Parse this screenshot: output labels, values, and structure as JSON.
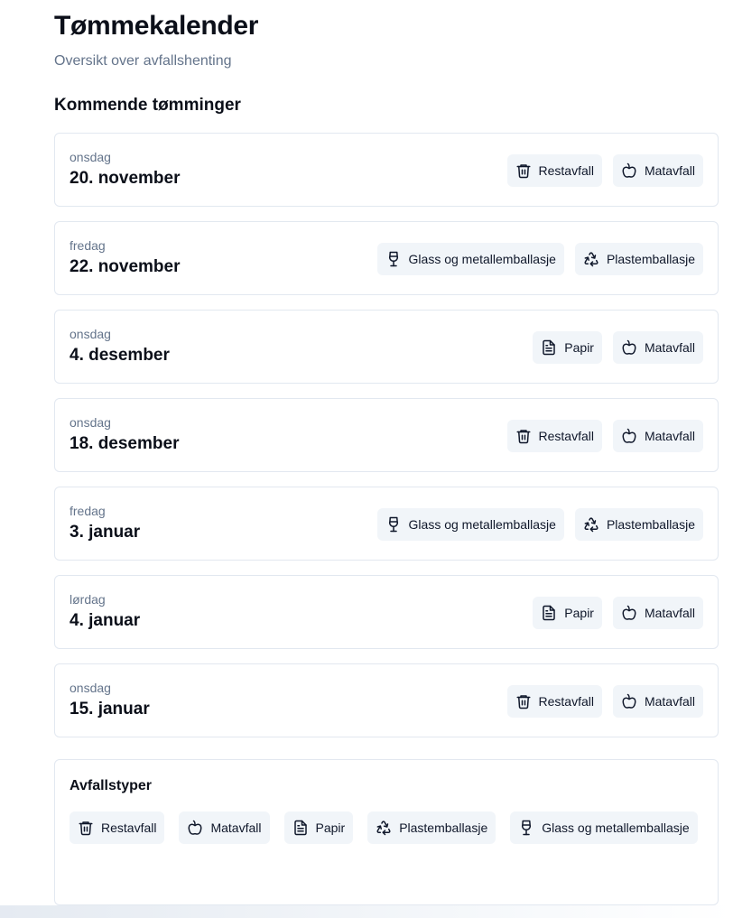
{
  "header": {
    "title": "Tømmekalender",
    "subtitle": "Oversikt over avfallshenting"
  },
  "upcoming": {
    "heading": "Kommende tømminger",
    "items": [
      {
        "day": "onsdag",
        "date": "20. november",
        "types": [
          {
            "label": "Restavfall",
            "icon": "trash-icon"
          },
          {
            "label": "Matavfall",
            "icon": "apple-icon"
          }
        ]
      },
      {
        "day": "fredag",
        "date": "22. november",
        "types": [
          {
            "label": "Glass og metallemballasje",
            "icon": "wine-glass-icon"
          },
          {
            "label": "Plastemballasje",
            "icon": "recycle-icon"
          }
        ]
      },
      {
        "day": "onsdag",
        "date": "4. desember",
        "types": [
          {
            "label": "Papir",
            "icon": "document-icon"
          },
          {
            "label": "Matavfall",
            "icon": "apple-icon"
          }
        ]
      },
      {
        "day": "onsdag",
        "date": "18. desember",
        "types": [
          {
            "label": "Restavfall",
            "icon": "trash-icon"
          },
          {
            "label": "Matavfall",
            "icon": "apple-icon"
          }
        ]
      },
      {
        "day": "fredag",
        "date": "3. januar",
        "types": [
          {
            "label": "Glass og metallemballasje",
            "icon": "wine-glass-icon"
          },
          {
            "label": "Plastemballasje",
            "icon": "recycle-icon"
          }
        ]
      },
      {
        "day": "lørdag",
        "date": "4. januar",
        "types": [
          {
            "label": "Papir",
            "icon": "document-icon"
          },
          {
            "label": "Matavfall",
            "icon": "apple-icon"
          }
        ]
      },
      {
        "day": "onsdag",
        "date": "15. januar",
        "types": [
          {
            "label": "Restavfall",
            "icon": "trash-icon"
          },
          {
            "label": "Matavfall",
            "icon": "apple-icon"
          }
        ]
      }
    ]
  },
  "legend": {
    "heading": "Avfallstyper",
    "types": [
      {
        "label": "Restavfall",
        "icon": "trash-icon"
      },
      {
        "label": "Matavfall",
        "icon": "apple-icon"
      },
      {
        "label": "Papir",
        "icon": "document-icon"
      },
      {
        "label": "Plastemballasje",
        "icon": "recycle-icon"
      },
      {
        "label": "Glass og metallemballasje",
        "icon": "wine-glass-icon"
      }
    ]
  },
  "colors": {
    "chip_bg": "#f1f5f9",
    "border": "#e2e8f0",
    "muted_text": "#64748b",
    "text": "#0f172a"
  }
}
